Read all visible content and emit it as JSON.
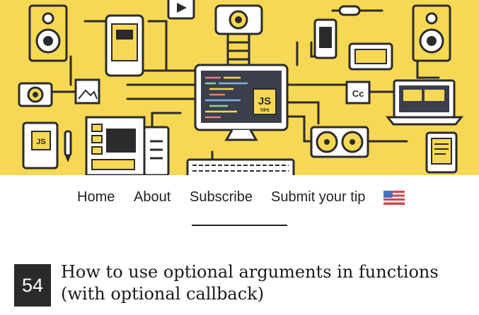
{
  "hero": {
    "badge_js": "JS",
    "badge_tips": "TIPS",
    "badge_cc": "Cc",
    "notebook_js": "JS",
    "colors": {
      "background": "#f6d855",
      "line": "#2b2b2b",
      "screen": "#3a3f4b"
    }
  },
  "nav": {
    "items": [
      {
        "label": "Home"
      },
      {
        "label": "About"
      },
      {
        "label": "Subscribe"
      },
      {
        "label": "Submit your tip"
      }
    ],
    "active_index": 2,
    "language_icon": "us-flag-icon"
  },
  "post": {
    "number": "54",
    "title_line1": "How to use optional arguments in functions",
    "title_line2": "(with optional callback)"
  }
}
